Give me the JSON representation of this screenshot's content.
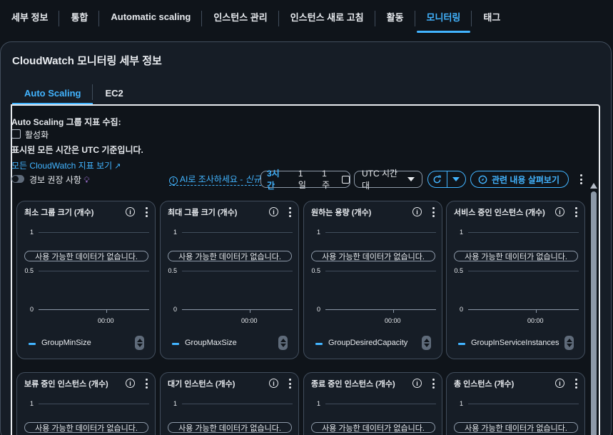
{
  "top_tabs": [
    {
      "label": "세부 정보",
      "active": false
    },
    {
      "label": "통합",
      "active": false
    },
    {
      "label": "Automatic scaling",
      "active": false
    },
    {
      "label": "인스턴스 관리",
      "active": false
    },
    {
      "label": "인스턴스 새로 고침",
      "active": false
    },
    {
      "label": "활동",
      "active": false
    },
    {
      "label": "모니터링",
      "active": true
    },
    {
      "label": "태그",
      "active": false
    }
  ],
  "panel": {
    "title": "CloudWatch 모니터링 세부 정보",
    "sub_tabs": [
      {
        "label": "Auto Scaling",
        "active": true
      },
      {
        "label": "EC2",
        "active": false
      }
    ]
  },
  "metrics_collection": {
    "label": "Auto Scaling 그룹 지표 수집:",
    "checkbox_label": "활성화",
    "checked": false
  },
  "utc_notice": "표시된 모든 시간은 UTC 기준입니다.",
  "view_all_link": "모든 CloudWatch 지표 보기",
  "toolbar": {
    "alarm_toggle_label": "경보 권장 사항",
    "ai_link": "AI로 조사하세요 - ",
    "ai_new": "신규",
    "time_ranges": [
      {
        "label": "3시간",
        "active": true
      },
      {
        "label": "1일",
        "active": false
      },
      {
        "label": "1주",
        "active": false
      }
    ],
    "timezone": "UTC 시간대",
    "related_button": "관련 내용 살펴보기"
  },
  "chart_common": {
    "no_data": "사용 가능한 데이터가 없습니다.",
    "y_ticks": [
      "1",
      "0.5",
      "0"
    ],
    "x_tick": "00:00"
  },
  "charts": [
    {
      "title": "최소 그룹 크기 (개수)",
      "legend": "GroupMinSize"
    },
    {
      "title": "최대 그룹 크기 (개수)",
      "legend": "GroupMaxSize"
    },
    {
      "title": "원하는 용량 (개수)",
      "legend": "GroupDesiredCapacity"
    },
    {
      "title": "서비스 중인 인스턴스 (개수)",
      "legend": "GroupInServiceInstances"
    },
    {
      "title": "보류 중인 인스턴스 (개수)",
      "legend": ""
    },
    {
      "title": "대기 인스턴스 (개수)",
      "legend": ""
    },
    {
      "title": "종료 중인 인스턴스 (개수)",
      "legend": ""
    },
    {
      "title": "총 인스턴스 (개수)",
      "legend": ""
    }
  ],
  "colors": {
    "accent": "#42b4ff",
    "background": "#0f141a",
    "panel": "#161d26",
    "border": "#414d5c"
  }
}
